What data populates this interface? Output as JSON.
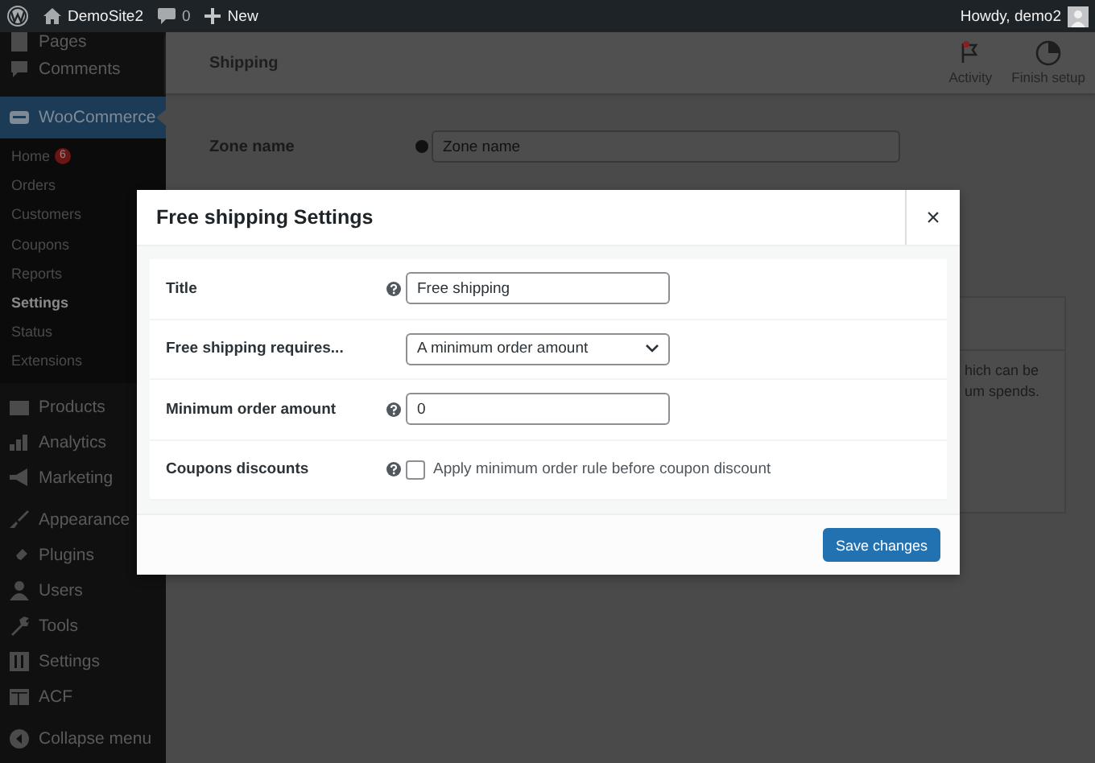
{
  "admin_bar": {
    "site_name": "DemoSite2",
    "comments_count": "0",
    "new_label": "New",
    "greeting": "Howdy, demo2"
  },
  "sidebar": {
    "items": [
      {
        "label": "Pages",
        "selected": false
      },
      {
        "label": "Comments",
        "selected": false
      },
      {
        "label": "WooCommerce",
        "selected": true,
        "children": [
          {
            "label": "Home",
            "selected": false,
            "badge": "6"
          },
          {
            "label": "Orders",
            "selected": false
          },
          {
            "label": "Customers",
            "selected": false
          },
          {
            "label": "Coupons",
            "selected": false
          },
          {
            "label": "Reports",
            "selected": false
          },
          {
            "label": "Settings",
            "selected": true
          },
          {
            "label": "Status",
            "selected": false
          },
          {
            "label": "Extensions",
            "selected": false
          }
        ]
      },
      {
        "label": "Products",
        "selected": false
      },
      {
        "label": "Analytics",
        "selected": false
      },
      {
        "label": "Marketing",
        "selected": false
      },
      {
        "label": "Appearance",
        "selected": false
      },
      {
        "label": "Plugins",
        "selected": false
      },
      {
        "label": "Users",
        "selected": false
      },
      {
        "label": "Tools",
        "selected": false
      },
      {
        "label": "Settings",
        "selected": false
      },
      {
        "label": "ACF",
        "selected": false
      },
      {
        "label": "Collapse menu",
        "selected": false
      }
    ]
  },
  "header": {
    "title": "Shipping",
    "actions": [
      {
        "kind": "activity",
        "label": "Activity"
      },
      {
        "kind": "setup",
        "label": "Finish setup"
      }
    ]
  },
  "zone_form": {
    "label": "Zone name",
    "placeholder": "Zone name"
  },
  "background_card": {
    "lines": [
      "hich can be",
      "um spends."
    ]
  },
  "modal": {
    "title": "Free shipping Settings",
    "close": "×",
    "fields": [
      {
        "kind": "text",
        "label": "Title",
        "help": true,
        "value": "Free shipping"
      },
      {
        "kind": "select",
        "label": "Free shipping requires...",
        "help": false,
        "value": "A minimum order amount"
      },
      {
        "kind": "text",
        "label": "Minimum order amount",
        "help": true,
        "value": "0"
      },
      {
        "kind": "checkbox",
        "label": "Coupons discounts",
        "help": true,
        "checked": false,
        "text": "Apply minimum order rule before coupon discount"
      }
    ],
    "save_button": "Save changes"
  }
}
